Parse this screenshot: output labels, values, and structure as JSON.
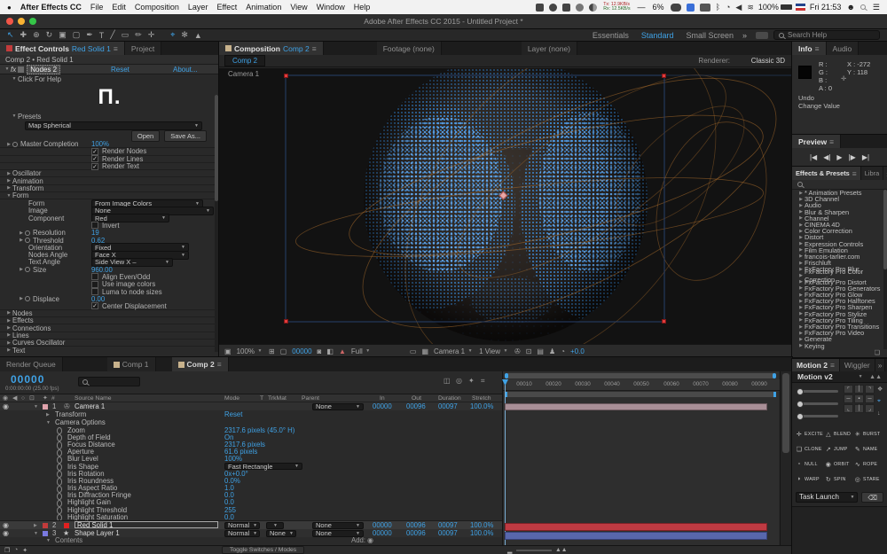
{
  "menubar": {
    "apple": "●",
    "items": [
      "After Effects CC",
      "File",
      "Edit",
      "Composition",
      "Layer",
      "Effect",
      "Animation",
      "View",
      "Window",
      "Help"
    ],
    "tx": "Tx: 12.9KB/s",
    "rx": "Rx: 12.5KB/s",
    "cpu": "6%",
    "battery": "100%",
    "clock": "Fri 21:53"
  },
  "titlebar": {
    "title": "Adobe After Effects CC 2015 - Untitled Project *"
  },
  "toolbar": {
    "tools": [
      "↖",
      "✚",
      "⊕",
      "↻",
      "▣",
      "▢",
      "✒",
      "T",
      "╱",
      "▭",
      "✏",
      "✛"
    ],
    "extra": [
      "⌖",
      "✻",
      "▲"
    ],
    "workspaces": [
      "Essentials",
      "Standard",
      "Small Screen"
    ],
    "chevron": "»",
    "search": "Search Help"
  },
  "effect_controls": {
    "tab_label": "Effect Controls",
    "tab_target": "Red Solid 1",
    "tab_project": "Project",
    "breadcrumb": "Comp 2 • Red Solid 1",
    "fx": "fx",
    "effect_name": "Nodes 2",
    "reset": "Reset",
    "about": "About...",
    "help": "Click For Help",
    "logo": "Π.",
    "presets_label": "Presets",
    "preset_value": "Map Spherical",
    "open_btn": "Open",
    "saveas_btn": "Save As...",
    "rows": [
      {
        "label": "Master Completion",
        "value": "100%"
      },
      {
        "label": "Render Nodes",
        "check": "✓"
      },
      {
        "label": "Render Lines",
        "check": "✓"
      },
      {
        "label": "Render Text",
        "check": "✓"
      },
      {
        "label": "Oscillator"
      },
      {
        "label": "Animation"
      },
      {
        "label": "Transform"
      },
      {
        "label": "Form"
      },
      {
        "label": "Form",
        "value": "From Image Colors"
      },
      {
        "label": "Image",
        "value": "None"
      },
      {
        "label": "Component",
        "value": "Red"
      },
      {
        "label": "Invert",
        "check": ""
      },
      {
        "label": "Resolution",
        "value": "19"
      },
      {
        "label": "Threshold",
        "value": "0.62"
      },
      {
        "label": "Orientation",
        "value": "Fixed"
      },
      {
        "label": "Nodes Angle",
        "value": "Face  X"
      },
      {
        "label": "Text Angle",
        "value": "Side View  X –"
      },
      {
        "label": "Size",
        "value": "960.00"
      },
      {
        "label": "Align Even/Odd",
        "check": ""
      },
      {
        "label": "Use image colors",
        "check": ""
      },
      {
        "label": "Luma to node sizes",
        "check": ""
      },
      {
        "label": "Displace",
        "value": "0.00"
      },
      {
        "label": "Center Displacement",
        "check": "✓"
      },
      {
        "label": "Nodes"
      },
      {
        "label": "Effects"
      },
      {
        "label": "Connections"
      },
      {
        "label": "Lines"
      },
      {
        "label": "Curves Oscillator"
      },
      {
        "label": "Text"
      }
    ]
  },
  "comp": {
    "tab_label": "Composition",
    "tab_target": "Comp 2",
    "tab_footage": "Footage (none)",
    "tab_layer": "Layer (none)",
    "comp_tab": "Comp 2",
    "renderer_label": "Renderer:",
    "renderer_value": "Classic 3D",
    "camera_label": "Camera 1",
    "toolbar": {
      "zoom": "100%",
      "frame": "00000",
      "resolution": "Full",
      "camera": "Camera 1",
      "views": "1 View",
      "exposure": "+0.0"
    }
  },
  "info": {
    "tab": "Info",
    "tab_audio": "Audio",
    "r": "R :",
    "g": "G :",
    "b": "B :",
    "a": "A : 0",
    "x": "X : -272",
    "y": "Y : 118",
    "undo": "Undo",
    "change": "Change Value"
  },
  "preview": {
    "tab": "Preview",
    "b1": "|◀",
    "b2": "◀|",
    "b3": "▶",
    "b4": "|▶",
    "b5": "▶|"
  },
  "presets_panel": {
    "tab": "Effects & Presets",
    "tab_library": "Libra",
    "chevron": "»",
    "items": [
      "* Animation Presets",
      "3D Channel",
      "Audio",
      "Blur & Sharpen",
      "Channel",
      "CINEMA 4D",
      "Color Correction",
      "Distort",
      "Expression Controls",
      "Film Emulation",
      "francois-tarlier.com",
      "Frischluft",
      "FxFactory Pro Blur",
      "FxFactory Pro Color Correction",
      "FxFactory Pro Distort",
      "FxFactory Pro Generators",
      "FxFactory Pro Glow",
      "FxFactory Pro Halftones",
      "FxFactory Pro Sharpen",
      "FxFactory Pro Stylize",
      "FxFactory Pro Tiling",
      "FxFactory Pro Transitions",
      "FxFactory Pro Video",
      "Generate",
      "Keying"
    ]
  },
  "motion": {
    "tab": "Motion 2",
    "tab_wiggler": "Wiggler",
    "chevron": "»",
    "title": "Motion v2",
    "grid": [
      "⌜",
      "│",
      "⌝",
      "─",
      "▪",
      "─",
      "⌞",
      "│",
      "⌟"
    ],
    "buttons": [
      {
        "label": "EXCITE",
        "icon": "✛"
      },
      {
        "label": "BLEND",
        "icon": "△"
      },
      {
        "label": "BURST",
        "icon": "✳"
      },
      {
        "label": "CLONE",
        "icon": "❏"
      },
      {
        "label": "JUMP",
        "icon": "↗"
      },
      {
        "label": "NAME",
        "icon": "✎"
      },
      {
        "label": "NULL",
        "icon": "▫"
      },
      {
        "label": "ORBIT",
        "icon": "◉"
      },
      {
        "label": "ROPE",
        "icon": "∿"
      },
      {
        "label": "WARP",
        "icon": "◗"
      },
      {
        "label": "SPIN",
        "icon": "↻"
      },
      {
        "label": "STARE",
        "icon": "◎"
      }
    ],
    "task": "Task Launch"
  },
  "timeline": {
    "tabs": {
      "render_queue": "Render Queue",
      "comp1": "Comp 1",
      "comp2": "Comp 2"
    },
    "timecode": "00000",
    "timecode_sub": "0:00:00:00 (25.00 fps)",
    "headers": {
      "num": "#",
      "source": "Source Name",
      "mode": "Mode",
      "t": "T",
      "trkmat": "TrkMat",
      "parent": "Parent",
      "in": "In",
      "out": "Out",
      "duration": "Duration",
      "stretch": "Stretch"
    },
    "ruler": [
      "00010",
      "00020",
      "00030",
      "00040",
      "00050",
      "00060",
      "00070",
      "00080",
      "00090"
    ],
    "camera_layer": {
      "num": "1",
      "name": "Camera 1"
    },
    "camera_values": {
      "parent": "None",
      "in": "00000",
      "out": "00096",
      "duration": "00097",
      "stretch": "100.0%"
    },
    "transform": {
      "label": "Transform",
      "reset": "Reset"
    },
    "camera_options_label": "Camera Options",
    "camera_options": [
      {
        "label": "Zoom",
        "value": "2317.6 pixels (45.0° H)"
      },
      {
        "label": "Depth of Field",
        "value": "On"
      },
      {
        "label": "Focus Distance",
        "value": "2317.6 pixels"
      },
      {
        "label": "Aperture",
        "value": "61.6 pixels"
      },
      {
        "label": "Blur Level",
        "value": "100%"
      },
      {
        "label": "Iris Shape",
        "value": "Fast Rectangle"
      },
      {
        "label": "Iris Rotation",
        "value": "0x+0.0°"
      },
      {
        "label": "Iris Roundness",
        "value": "0.0%"
      },
      {
        "label": "Iris Aspect Ratio",
        "value": "1.0"
      },
      {
        "label": "Iris Diffraction Fringe",
        "value": "0.0"
      },
      {
        "label": "Highlight Gain",
        "value": "0.0"
      },
      {
        "label": "Highlight Threshold",
        "value": "255"
      },
      {
        "label": "Highlight Saturation",
        "value": "0.0"
      }
    ],
    "red_layer": {
      "num": "2",
      "name": "Red Solid 1",
      "mode": "Normal",
      "parent": "None",
      "in": "00000",
      "out": "00096",
      "duration": "00097",
      "stretch": "100.0%"
    },
    "shape_layer": {
      "num": "3",
      "name": "Shape Layer 1",
      "mode": "Normal",
      "trkmat": "None",
      "parent": "None",
      "in": "00000",
      "out": "00096",
      "duration": "00097",
      "stretch": "100.0%"
    },
    "contents": "Contents",
    "add": "Add:",
    "toggle": "Toggle Switches / Modes"
  }
}
